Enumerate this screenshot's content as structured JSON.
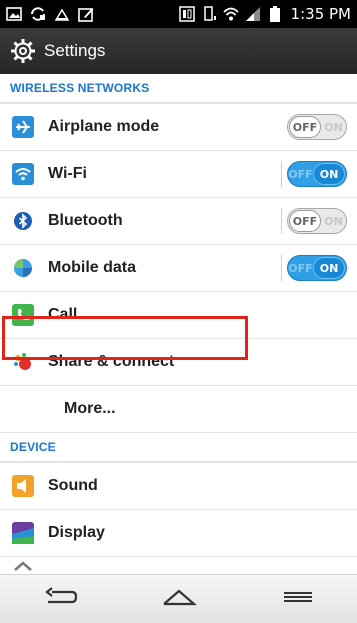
{
  "status_bar": {
    "time": "1:35 PM"
  },
  "action_bar": {
    "title": "Settings"
  },
  "sections": {
    "wireless": {
      "header": "WIRELESS NETWORKS",
      "airplane": {
        "label": "Airplane mode",
        "toggle_off": "OFF",
        "toggle_on": "ON"
      },
      "wifi": {
        "label": "Wi-Fi",
        "toggle_off": "OFF",
        "toggle_on": "ON"
      },
      "bluetooth": {
        "label": "Bluetooth",
        "toggle_off": "OFF",
        "toggle_on": "ON"
      },
      "mobile": {
        "label": "Mobile data",
        "toggle_off": "OFF",
        "toggle_on": "ON"
      },
      "call": {
        "label": "Call"
      },
      "share": {
        "label": "Share & connect"
      },
      "more": {
        "label": "More..."
      }
    },
    "device": {
      "header": "DEVICE",
      "sound": {
        "label": "Sound"
      },
      "display": {
        "label": "Display"
      }
    }
  },
  "colors": {
    "accent": "#1976d2",
    "toggle_on": "#2f9fe6",
    "highlight": "#e2231a"
  }
}
